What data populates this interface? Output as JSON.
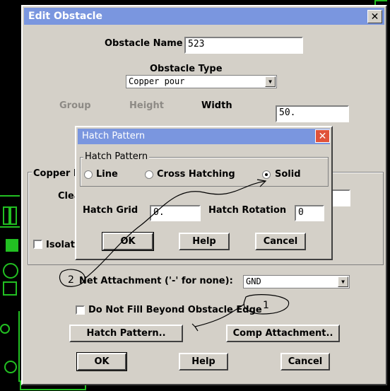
{
  "main_dialog": {
    "title": "Edit Obstacle",
    "close_glyph": "✕",
    "obstacle_name_label": "Obstacle Name",
    "obstacle_name_value": "523",
    "obstacle_type_label": "Obstacle Type",
    "obstacle_type_value": "Copper pour",
    "group_label": "Group",
    "height_label": "Height",
    "width_label": "Width",
    "width_value": "50.",
    "copper_group_label": "Copper P",
    "clearance_label": "Clea",
    "isolate_label": "Isolate",
    "net_attachment_label": "Net Attachment ('-' for none):",
    "net_attachment_value": "GND",
    "do_not_fill_label": "Do Not Fill Beyond Obstacle Edge",
    "hatch_pattern_button": "Hatch Pattern..",
    "comp_attachment_button": "Comp Attachment..",
    "ok_button": "OK",
    "help_button": "Help",
    "cancel_button": "Cancel"
  },
  "hatch_dialog": {
    "title": "Hatch Pattern",
    "close_glyph": "✕",
    "group_label": "Hatch Pattern",
    "options": [
      "Line",
      "Cross Hatching",
      "Solid"
    ],
    "selected_option": "Solid",
    "hatch_grid_label": "Hatch Grid",
    "hatch_grid_value": "0.",
    "hatch_rotation_label": "Hatch Rotation",
    "hatch_rotation_value": "0",
    "ok_button": "OK",
    "help_button": "Help",
    "cancel_button": "Cancel"
  },
  "annotations": {
    "mark_1": "1",
    "mark_2": "2"
  },
  "colors": {
    "titlebar": "#7a96df",
    "dialog_face": "#d4d0c8",
    "pcb_green": "#22c022",
    "close_red": "#e0523a"
  }
}
